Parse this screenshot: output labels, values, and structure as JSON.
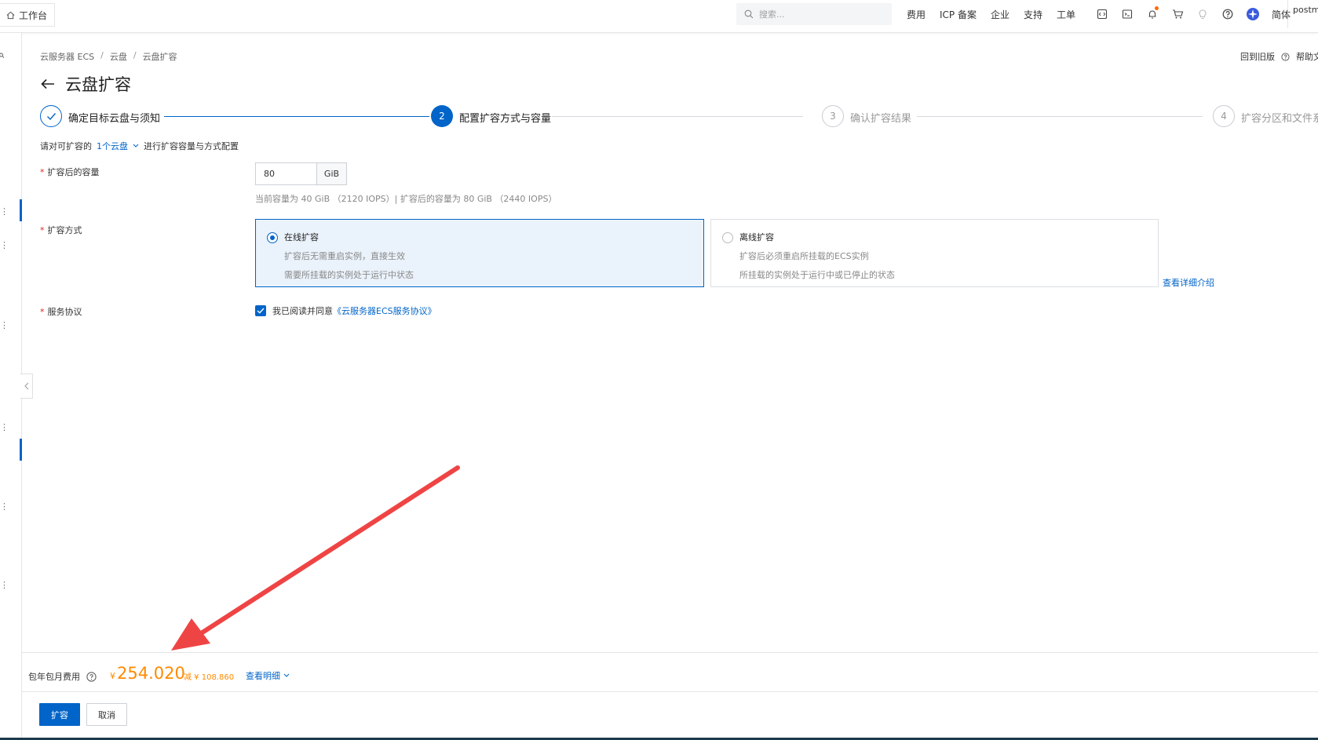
{
  "topbar": {
    "workbench_label": "工作台",
    "search_placeholder": "搜索...",
    "nav_items": [
      "费用",
      "ICP 备案",
      "企业",
      "支持",
      "工单"
    ],
    "lang": "简体",
    "user": "postm"
  },
  "breadcrumb": [
    "云服务器 ECS",
    "云盘",
    "云盘扩容"
  ],
  "page_title": "云盘扩容",
  "header_links": {
    "old_version": "回到旧版",
    "help": "帮助文"
  },
  "steps": [
    {
      "num": "1",
      "label": "确定目标云盘与须知",
      "state": "done"
    },
    {
      "num": "2",
      "label": "配置扩容方式与容量",
      "state": "active"
    },
    {
      "num": "3",
      "label": "确认扩容结果",
      "state": "pending"
    },
    {
      "num": "4",
      "label": "扩容分区和文件系",
      "state": "pending"
    }
  ],
  "hint": {
    "prefix": "请对可扩容的",
    "link": "1个云盘",
    "suffix": "进行扩容容量与方式配置"
  },
  "form": {
    "capacity_label": "扩容后的容量",
    "capacity_value": "80",
    "capacity_unit": "GiB",
    "capacity_hint": "当前容量为 40 GiB （2120 IOPS）| 扩容后的容量为 80 GiB （2440 IOPS）",
    "method_label": "扩容方式",
    "online": {
      "title": "在线扩容",
      "line1": "扩容后无需重启实例，直接生效",
      "line2": "需要所挂载的实例处于运行中状态"
    },
    "offline": {
      "title": "离线扩容",
      "line1": "扩容后必须重启所挂载的ECS实例",
      "line2": "所挂载的实例处于运行中或已停止的状态"
    },
    "detail_link": "查看详细介绍",
    "agreement_label": "服务协议",
    "agreement_text": "我已阅读并同意",
    "agreement_link": "《云服务器ECS服务协议》"
  },
  "footer": {
    "fee_label": "包年包月费用",
    "currency": "¥",
    "price": "254.020",
    "discount": "减 ¥ 108.860",
    "detail": "查看明细",
    "confirm_btn": "扩容",
    "cancel_btn": "取消"
  },
  "colors": {
    "primary": "#0064c8",
    "price": "#ff8a00",
    "annotation": "#ef4444"
  }
}
